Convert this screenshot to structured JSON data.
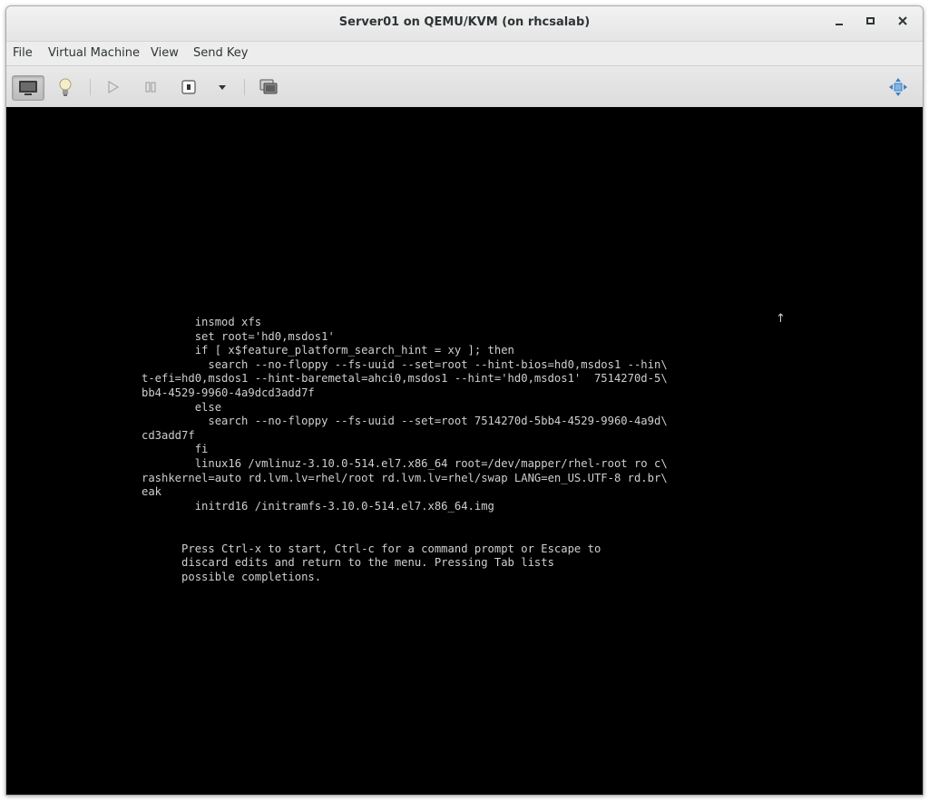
{
  "window": {
    "title": "Server01 on QEMU/KVM (on rhcsalab)",
    "controls": {
      "minimize": "_",
      "maximize": "□",
      "close": "×"
    }
  },
  "menu": [
    "File",
    "Virtual Machine",
    "View",
    "Send Key"
  ],
  "toolbar": {
    "icons": [
      "monitor-icon",
      "lightbulb-icon",
      "play-icon",
      "pause-icon",
      "power-icon",
      "dropdown-arrow-icon",
      "snapshot-icon",
      "fullscreen-move-icon"
    ]
  },
  "console": {
    "scroll_indicator": "↑",
    "lines": [
      "        insmod xfs",
      "        set root='hd0,msdos1'",
      "        if [ x$feature_platform_search_hint = xy ]; then",
      "          search --no-floppy --fs-uuid --set=root --hint-bios=hd0,msdos1 --hin\\",
      "t-efi=hd0,msdos1 --hint-baremetal=ahci0,msdos1 --hint='hd0,msdos1'  7514270d-5\\",
      "bb4-4529-9960-4a9dcd3add7f",
      "        else",
      "          search --no-floppy --fs-uuid --set=root 7514270d-5bb4-4529-9960-4a9d\\",
      "cd3add7f",
      "        fi",
      "        linux16 /vmlinuz-3.10.0-514.el7.x86_64 root=/dev/mapper/rhel-root ro c\\",
      "rashkernel=auto rd.lvm.lv=rhel/root rd.lvm.lv=rhel/swap LANG=en_US.UTF-8 rd.br\\",
      "eak",
      "        initrd16 /initramfs-3.10.0-514.el7.x86_64.img",
      "",
      "",
      "      Press Ctrl-x to start, Ctrl-c for a command prompt or Escape to",
      "      discard edits and return to the menu. Pressing Tab lists",
      "      possible completions."
    ]
  }
}
